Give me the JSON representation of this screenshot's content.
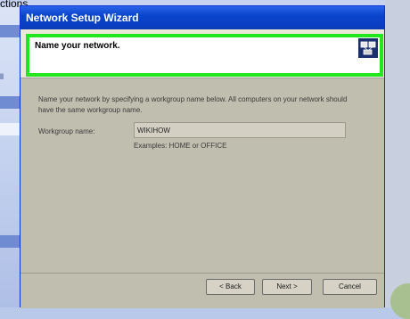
{
  "background": {
    "top_label": "ctions",
    "side_label_1": "ll"
  },
  "window": {
    "title": "Network Setup Wizard"
  },
  "header": {
    "title": "Name your network.",
    "icon": "network-computers-icon"
  },
  "body": {
    "intro": "Name your network by specifying a workgroup name below. All computers on your network should have the same workgroup name.",
    "workgroup_label": "Workgroup name:",
    "workgroup_value": "WIKIHOW",
    "examples": "Examples: HOME or OFFICE"
  },
  "buttons": {
    "back": "< Back",
    "next": "Next >",
    "cancel": "Cancel"
  },
  "colors": {
    "highlight": "#22e61e",
    "titlebar": "#0a44cc"
  }
}
